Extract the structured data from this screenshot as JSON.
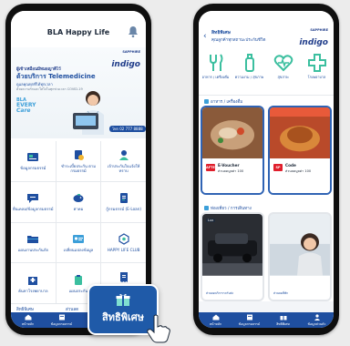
{
  "left_screen": {
    "app_title": "BLA Happy Life",
    "banner": {
      "tier": "SAPPHIRE",
      "brand": "indigo",
      "line1": "ผู้เข้าเหมือนมีหมอญาติไว้",
      "line2": "ด้วยบริการ Telemedicine",
      "line3": "ดูแลคุณทุกที่ได้ทุกเวลา",
      "line4": "ด้วยความรักและใส่ใจในทุกช่วงเวลา COVID-19",
      "every_logo": [
        "BLA",
        "EVERY",
        "Care"
      ],
      "cta": "โทร 02 777 8888"
    },
    "grid": [
      {
        "label": "ข้อมูลกรมธรรม์",
        "icon": "policy-card-icon"
      },
      {
        "label": "ชำระเบี้ยประกัน ตามกรมธรรม์",
        "icon": "payment-coin-icon"
      },
      {
        "label": "เจ้าประกันใบแจ้งให้ทราบ",
        "icon": "claim-person-icon"
      },
      {
        "label": "ยื่นเคลม/ข้อมูลกรมธรรม์",
        "icon": "chat-bubble-icon"
      },
      {
        "label": "ค่าคม",
        "icon": "piggy-icon"
      },
      {
        "label": "กู้กรมธรรม์ (E-Loan)",
        "icon": "document-icon"
      },
      {
        "label": "แผนงานประกันภัย",
        "icon": "folder-icon"
      },
      {
        "label": "เปลี่ยนแปลงข้อมูล",
        "icon": "id-card-icon"
      },
      {
        "label": "HAPPY LIFE CLUB",
        "icon": "club-icon"
      },
      {
        "label": "ค้นหาโรงพยาบาล",
        "icon": "hospital-icon"
      },
      {
        "label": "แผนประกัน",
        "icon": "plan-icon"
      },
      {
        "label": "ขอรับบิล e-Receipt / e-Document",
        "icon": "receipt-icon"
      }
    ],
    "peek_left": "สิทธิพิเศษ",
    "peek_mid": "ส่วนลด",
    "nav": [
      {
        "label": "หน้าหลัก",
        "icon": "home-icon"
      },
      {
        "label": "ข้อมูลกรมธรรม์",
        "icon": "policy-icon"
      },
      {
        "label": "สิทธิพิเศษ",
        "icon": "gift-icon"
      },
      {
        "label": "ข้อมูลส่วนตัว",
        "icon": "profile-icon"
      }
    ],
    "callout": {
      "label": "สิทธิพิเศษ",
      "icon": "gift-icon"
    }
  },
  "right_screen": {
    "header": {
      "back": "‹",
      "title": "สิทธิพิเศษ",
      "subtitle": "คุณลูกค้าทุกสถานะประกันชีวิต",
      "tier": "SAPPHIRE",
      "brand": "indigo"
    },
    "categories": [
      {
        "label": "อาหาร / เครื่องดื่ม",
        "icon": "dining-icon"
      },
      {
        "label": "ความงาม / สุขภาพ",
        "icon": "beauty-icon"
      },
      {
        "label": "สุขภาพ",
        "icon": "health-heart-icon"
      },
      {
        "label": "โรงพยาบาล",
        "icon": "medical-cross-icon"
      }
    ],
    "section1": "อาหาร / เครื่องดื่ม",
    "section2": "ท่องเที่ยว / การเดินทาง",
    "cards": [
      {
        "logo": "AFTER",
        "title": "E-Voucher",
        "subtitle": "ส่วนลดมูลค่า 100",
        "selected": true
      },
      {
        "logo": "SP",
        "title": "Code",
        "subtitle": "ส่วนลดมูลค่า 100",
        "selected": true
      },
      {
        "tag": "Lux",
        "caption": "ส่วนลดบริการรถรับส่ง",
        "selected": false
      },
      {
        "tag": "",
        "caption": "ส่วนลดที่พัก",
        "selected": false
      }
    ],
    "nav": [
      {
        "label": "หน้าหลัก",
        "icon": "home-icon"
      },
      {
        "label": "ข้อมูลกรมธรรม์",
        "icon": "policy-icon"
      },
      {
        "label": "สิทธิพิเศษ",
        "icon": "gift-icon"
      },
      {
        "label": "ข้อมูลส่วนตัว",
        "icon": "profile-icon"
      }
    ]
  },
  "colors": {
    "primary": "#1f4fa0",
    "accent": "#3c9fd9",
    "mint": "#3bbf9f"
  }
}
